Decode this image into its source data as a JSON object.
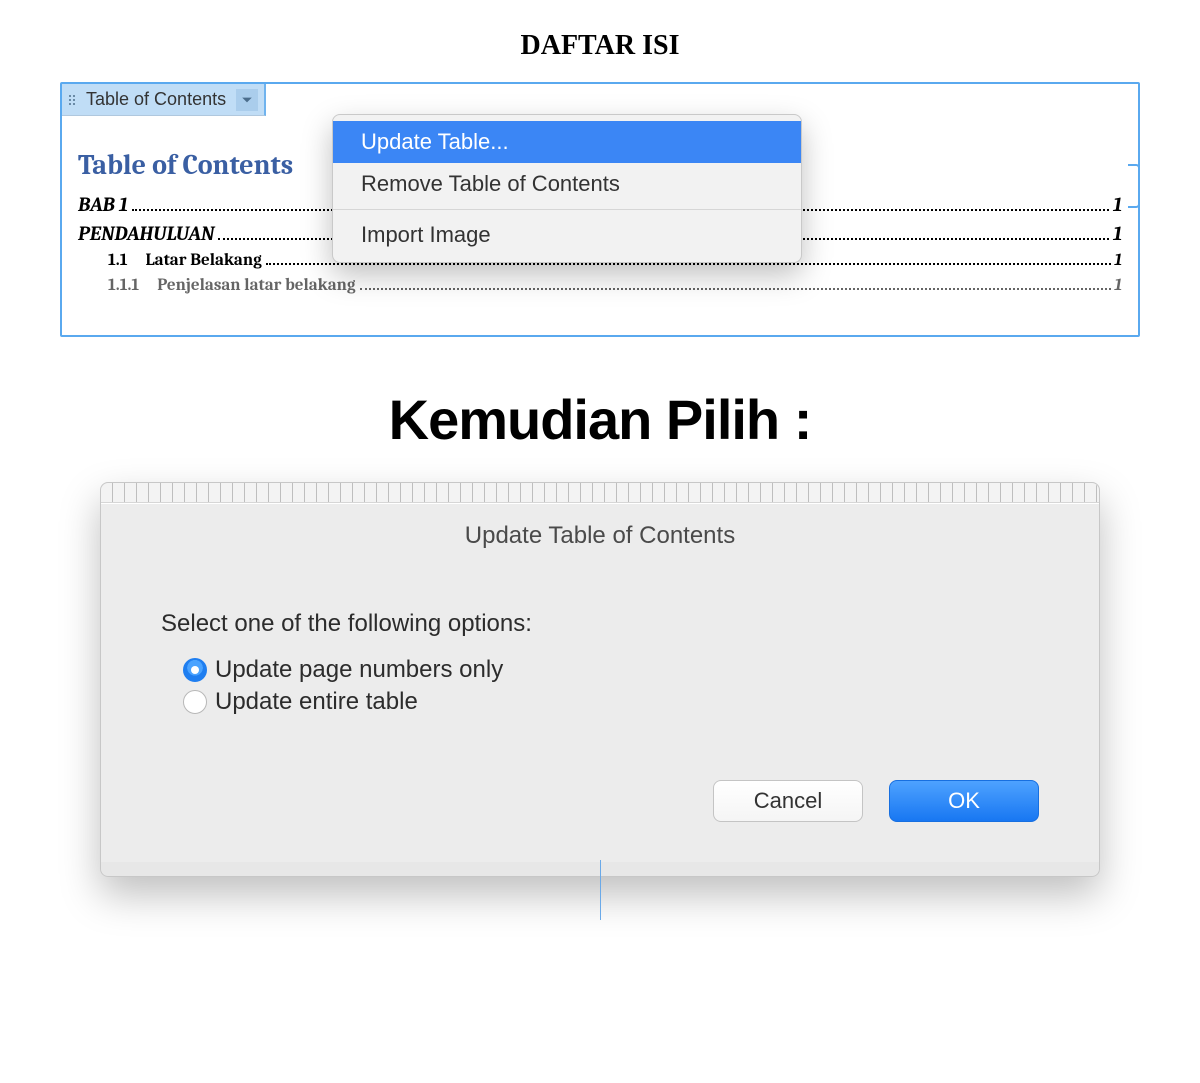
{
  "doc": {
    "title": "DAFTAR ISI"
  },
  "toc_field": {
    "tab_label": "Table of Contents",
    "heading": "Table of Contents",
    "entries": [
      {
        "number": "",
        "label": "BAB 1",
        "page": "1",
        "style": "h1"
      },
      {
        "number": "",
        "label": "PENDAHULUAN",
        "page": "1",
        "style": "h1"
      },
      {
        "number": "1.1",
        "label": "Latar Belakang",
        "page": "1",
        "style": "h2"
      },
      {
        "number": "1.1.1",
        "label": "Penjelasan latar belakang",
        "page": "1",
        "style": "h3"
      }
    ]
  },
  "context_menu": {
    "items": [
      {
        "label": "Update Table...",
        "highlighted": true
      },
      {
        "label": "Remove Table of Contents",
        "highlighted": false
      }
    ],
    "separator_after": 1,
    "extra_items": [
      {
        "label": "Import Image",
        "highlighted": false
      }
    ]
  },
  "between_heading": "Kemudian Pilih :",
  "dialog": {
    "title": "Update Table of Contents",
    "prompt": "Select one of the following options:",
    "options": [
      {
        "label": "Update page numbers only",
        "selected": true
      },
      {
        "label": "Update entire table",
        "selected": false
      }
    ],
    "buttons": {
      "cancel": "Cancel",
      "ok": "OK"
    }
  }
}
